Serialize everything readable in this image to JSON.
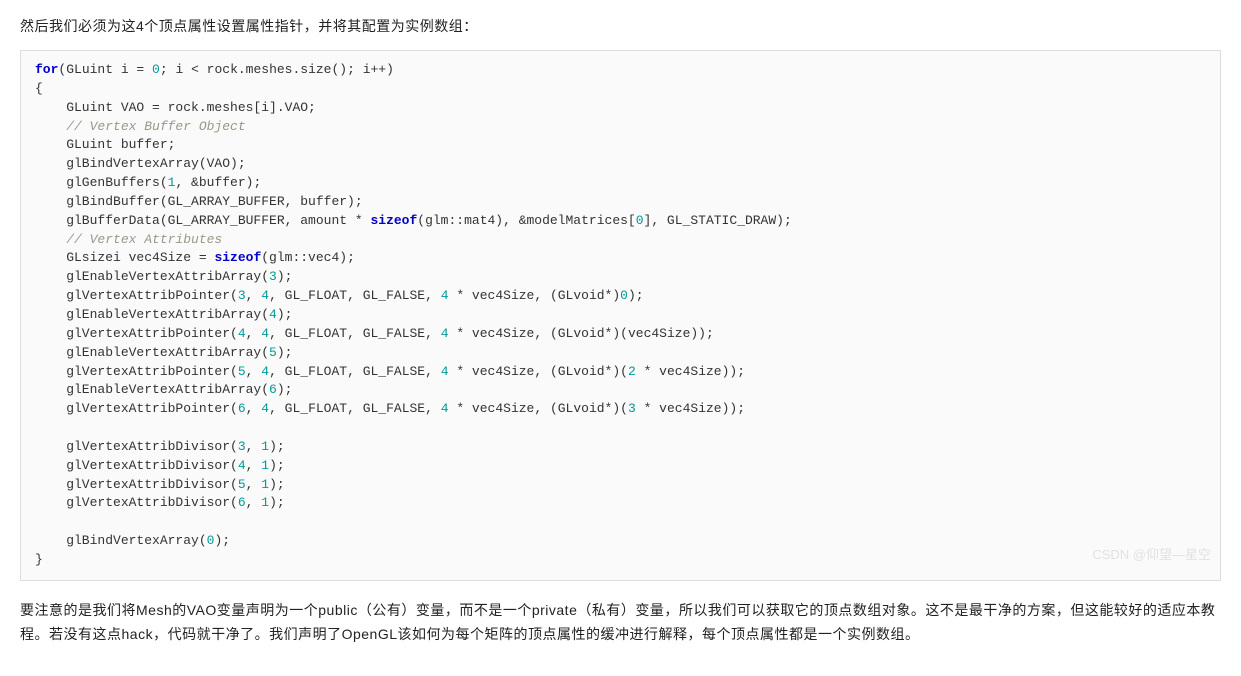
{
  "intro": "然后我们必须为这4个顶点属性设置属性指针，并将其配置为实例数组：",
  "code": {
    "kw_for": "for",
    "lparen": "(",
    "decl_gluint": "GLuint i = ",
    "zero": "0",
    "cond": "; i < rock.meshes.size(); i++)",
    "lbrace": "{",
    "line_vao": "    GLuint VAO = rock.meshes[i].VAO;",
    "line_cmt1": "    // Vertex Buffer Object",
    "line_buffer": "    GLuint buffer;",
    "line_bindvao": "    glBindVertexArray(VAO);",
    "line_gen1": "    glGenBuffers(",
    "one_a": "1",
    "line_gen2": ", &buffer);",
    "line_bindbuf": "    glBindBuffer(GL_ARRAY_BUFFER, buffer);",
    "line_bufdata1": "    glBufferData(GL_ARRAY_BUFFER, amount * ",
    "kw_sizeof1": "sizeof",
    "line_bufdata2": "(glm::mat4), &modelMatrices[",
    "zero_b": "0",
    "line_bufdata3": "], GL_STATIC_DRAW);",
    "line_cmt2": "    // Vertex Attributes",
    "line_glsizei1": "    GLsizei vec4Size = ",
    "kw_sizeof2": "sizeof",
    "line_glsizei2": "(glm::vec4);",
    "line_en3a": "    glEnableVertexAttribArray(",
    "n3": "3",
    "rparen_semi": ");",
    "line_ptr3a": "    glVertexAttribPointer(",
    "n3b": "3",
    "comma_sp": ", ",
    "n4": "4",
    "ptr_mid": ", GL_FLOAT, GL_FALSE, ",
    "n4b": "4",
    "ptr_mul": " * vec4Size, (GLvoid*)",
    "n0c": "0",
    "line_en4a": "    glEnableVertexAttribArray(",
    "n4c": "4",
    "line_ptr4a": "    glVertexAttribPointer(",
    "n4d": "4",
    "n4e": "4",
    "n4f": "4",
    "ptr_end_v": " * vec4Size, (GLvoid*)(vec4Size));",
    "line_en5a": "    glEnableVertexAttribArray(",
    "n5": "5",
    "line_ptr5a": "    glVertexAttribPointer(",
    "n5b": "5",
    "n4g": "4",
    "n4h": "4",
    "ptr_end_2v1": " * vec4Size, (GLvoid*)(",
    "n2": "2",
    "ptr_end_2v2": " * vec4Size));",
    "line_en6a": "    glEnableVertexAttribArray(",
    "n6": "6",
    "line_ptr6a": "    glVertexAttribPointer(",
    "n6b": "6",
    "n4i": "4",
    "n4j": "4",
    "n3c": "3",
    "line_div3a": "    glVertexAttribDivisor(",
    "n3d": "3",
    "n1b": "1",
    "line_div4a": "    glVertexAttribDivisor(",
    "n4k": "4",
    "n1c": "1",
    "line_div5a": "    glVertexAttribDivisor(",
    "n5c": "5",
    "n1d": "1",
    "line_div6a": "    glVertexAttribDivisor(",
    "n6c": "6",
    "n1e": "1",
    "line_bind0a": "    glBindVertexArray(",
    "n0d": "0",
    "rbrace": "}"
  },
  "outro": "要注意的是我们将Mesh的VAO变量声明为一个public（公有）变量，而不是一个private（私有）变量，所以我们可以获取它的顶点数组对象。这不是最干净的方案，但这能较好的适应本教程。若没有这点hack，代码就干净了。我们声明了OpenGL该如何为每个矩阵的顶点属性的缓冲进行解释，每个顶点属性都是一个实例数组。",
  "watermark": "CSDN @仰望—星空"
}
